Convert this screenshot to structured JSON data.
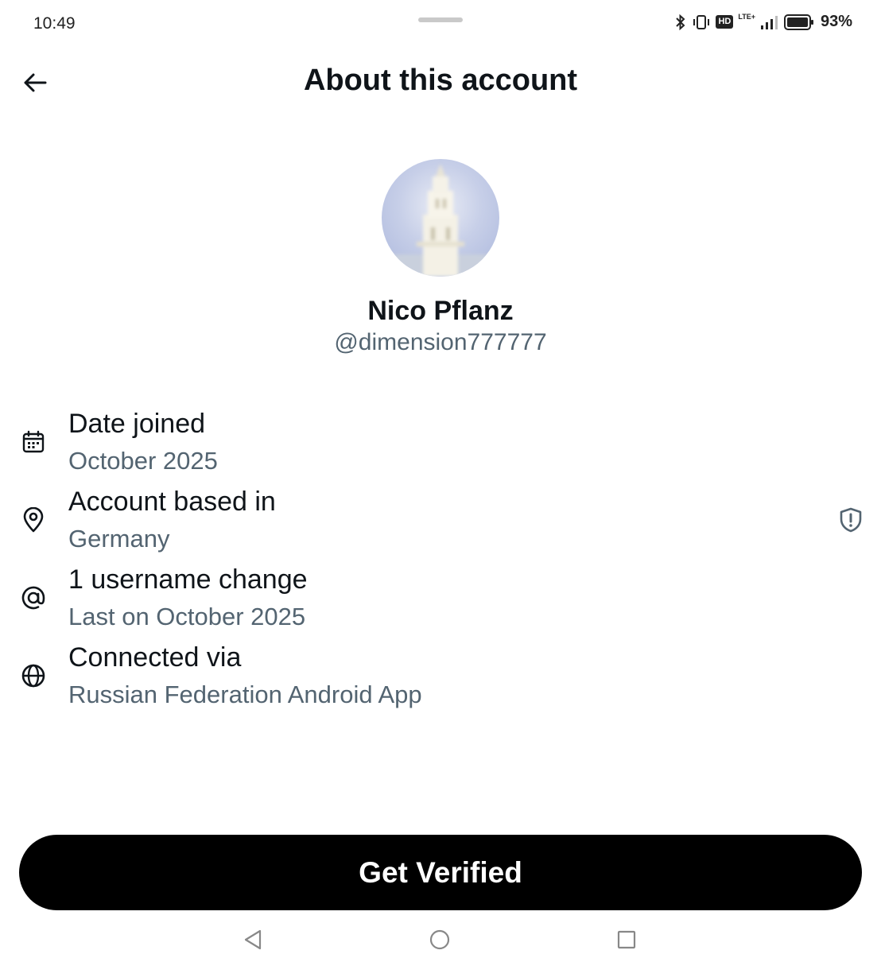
{
  "status_bar": {
    "time": "10:49",
    "battery": "93%",
    "hd_label": "HD",
    "lte_label": "LTE+"
  },
  "header": {
    "title": "About this account",
    "back_icon": "arrow-left-icon"
  },
  "profile": {
    "display_name": "Nico Pflanz",
    "handle": "@dimension777777"
  },
  "info_rows": [
    {
      "icon": "calendar-icon",
      "label": "Date joined",
      "value": "October 2025"
    },
    {
      "icon": "location-pin-icon",
      "label": "Account based in",
      "value": "Germany",
      "trailing_icon": "shield-alert-icon"
    },
    {
      "icon": "at-sign-icon",
      "label": "1 username change",
      "value": "Last on October 2025"
    },
    {
      "icon": "globe-icon",
      "label": "Connected via",
      "value": "Russian Federation Android App"
    }
  ],
  "cta": {
    "label": "Get Verified"
  },
  "colors": {
    "primary_text": "#0f1419",
    "secondary_text": "#536471",
    "button_bg": "#000000",
    "button_text": "#ffffff"
  }
}
